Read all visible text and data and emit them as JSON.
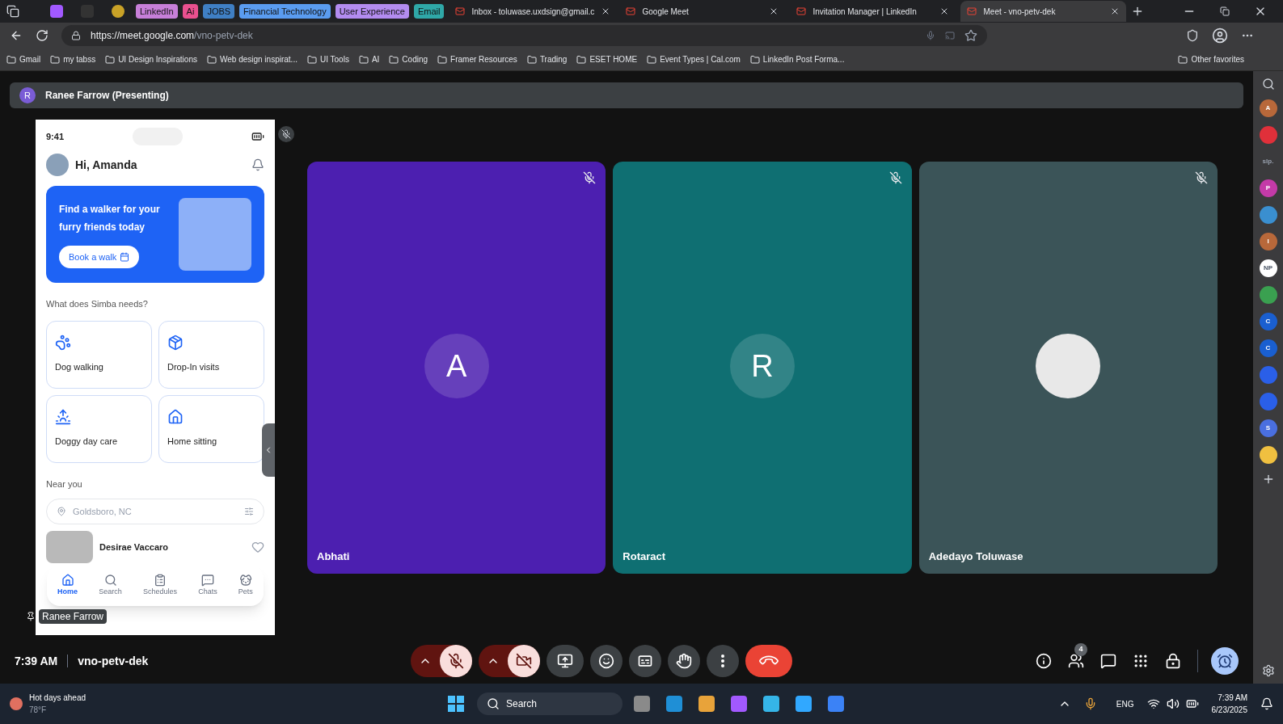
{
  "tab_groups": [
    {
      "label": "LinkedIn",
      "color": "#c77fd9"
    },
    {
      "label": "Ai",
      "color": "#e9508f"
    },
    {
      "label": "JOBS",
      "color": "#3f7fc4"
    },
    {
      "label": "Financial Technology",
      "color": "#5a9cf0"
    },
    {
      "label": "User Experience",
      "color": "#b38cf0"
    },
    {
      "label": "Email",
      "color": "#2fa8a8"
    }
  ],
  "tabs": [
    {
      "title": "Inbox - toluwase.uxdsign@gmail.c",
      "selected": false
    },
    {
      "title": "Google Meet",
      "selected": false
    },
    {
      "title": "Invitation Manager | LinkedIn",
      "selected": false
    },
    {
      "title": "Meet - vno-petv-dek",
      "selected": true
    }
  ],
  "address_bar": {
    "host": "https://meet.google.com",
    "path": "/vno-petv-dek"
  },
  "bookmarks": [
    "Gmail",
    "my tabss",
    "UI Design Inspirations",
    "Web design inspirat...",
    "UI Tools",
    "AI",
    "Coding",
    "Framer Resources",
    "Trading",
    "ESET HOME",
    "Event Types | Cal.com",
    "LinkedIn Post Forma..."
  ],
  "other_favorites": "Other favorites",
  "presenting_bar": {
    "initial": "R",
    "label": "Ranee Farrow (Presenting)"
  },
  "presentation": {
    "status_time": "9:41",
    "greeting": "Hi, Amanda",
    "banner": {
      "title": "Find a walker for your furry friends today",
      "button": "Book a walk"
    },
    "section_title": "What does Simba needs?",
    "services": [
      {
        "kind": "paw",
        "label": "Dog walking"
      },
      {
        "kind": "bowl",
        "label": "Drop-In visits"
      },
      {
        "kind": "sun",
        "label": "Doggy day care"
      },
      {
        "kind": "house",
        "label": "Home sitting"
      }
    ],
    "near_title": "Near you",
    "location_placeholder": "Goldsboro, NC",
    "listing": {
      "name": "Desirae Vaccaro"
    },
    "nav": [
      {
        "kind": "home",
        "label": "Home",
        "selected": true
      },
      {
        "kind": "search",
        "label": "Search",
        "selected": false
      },
      {
        "kind": "schedules",
        "label": "Schedules",
        "selected": false
      },
      {
        "kind": "chats",
        "label": "Chats",
        "selected": false
      },
      {
        "kind": "pets",
        "label": "Pets",
        "selected": false
      }
    ],
    "presenter_name": "Ranee Farrow"
  },
  "participants": [
    {
      "name": "Abhati",
      "kind": "initial",
      "initial": "A",
      "color": "#4c1fb0"
    },
    {
      "name": "Rotaract",
      "kind": "initial",
      "initial": "R",
      "color": "#0f6f72"
    },
    {
      "name": "Adedayo Toluwase",
      "kind": "photo",
      "color": "#3b5458"
    }
  ],
  "meeting": {
    "time": "7:39 AM",
    "code": "vno-petv-dek",
    "mic_on": false,
    "camera_on": false,
    "people_count": "4"
  },
  "sidebar_apps": [
    {
      "glyph": "A",
      "color": "#b8683a"
    },
    {
      "color": "#e0303a"
    },
    {
      "glyph": "slp."
    },
    {
      "glyph": "P",
      "color": "#c43aa8"
    },
    {
      "color": "#3a8fd0"
    },
    {
      "glyph": "I",
      "color": "#b8683a"
    },
    {
      "glyph": "NP",
      "color": "#ffffff"
    },
    {
      "color": "#3aa050"
    },
    {
      "glyph": "C",
      "color": "#1a5fd0"
    },
    {
      "glyph": "C",
      "color": "#1a5fd0"
    },
    {
      "color": "#2a5fe8"
    },
    {
      "color": "#2a5fe8"
    },
    {
      "glyph": "S",
      "color": "#4a6fe0"
    },
    {
      "color": "#f0c040"
    }
  ],
  "taskbar": {
    "weather_title": "Hot days ahead",
    "weather_temp": "78°F",
    "search": "Search",
    "language": "ENG",
    "time": "7:39 AM",
    "date": "6/23/2025"
  }
}
